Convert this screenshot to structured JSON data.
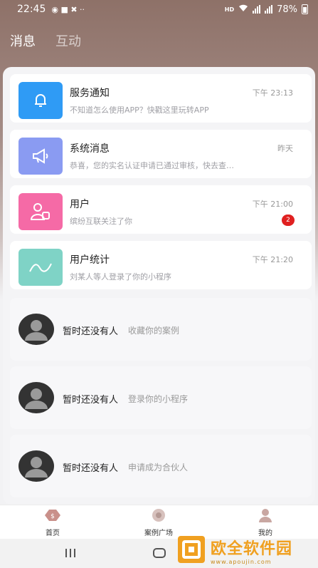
{
  "status_bar": {
    "time": "22:45",
    "hd_label": "HD",
    "battery": "78%"
  },
  "tabs": [
    {
      "label": "消息",
      "active": true
    },
    {
      "label": "互动",
      "active": false
    }
  ],
  "messages": [
    {
      "title": "服务通知",
      "subtitle": "不知道怎么使用APP？快戳这里玩转APP",
      "time": "下午 23:13",
      "icon": "bell-icon",
      "color": "#2f9bf5"
    },
    {
      "title": "系统消息",
      "subtitle": "恭喜，您的实名认证申请已通过审核，快去查…",
      "time": "昨天",
      "icon": "megaphone-icon",
      "color": "#8a9bf2"
    },
    {
      "title": "用户",
      "subtitle": "缤纷互联关注了你",
      "time": "下午 21:00",
      "icon": "users-icon",
      "color": "#f56aa6",
      "badge": "2"
    },
    {
      "title": "用户统计",
      "subtitle": "刘某人等人登录了你的小程序",
      "time": "下午 21:20",
      "icon": "wave-icon",
      "color": "#7fd3c6"
    }
  ],
  "empty_rows": [
    {
      "name": "暂时还没有人",
      "desc": "收藏你的案例"
    },
    {
      "name": "暂时还没有人",
      "desc": "登录你的小程序"
    },
    {
      "name": "暂时还没有人",
      "desc": "申请成为合伙人"
    }
  ],
  "tabbar": [
    {
      "label": "首页"
    },
    {
      "label": "案例广场"
    },
    {
      "label": "我的"
    }
  ],
  "watermark": {
    "title": "欧全软件园",
    "url": "www.apoujin.com"
  }
}
